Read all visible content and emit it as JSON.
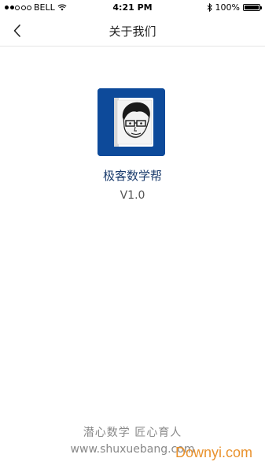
{
  "status_bar": {
    "carrier": "BELL",
    "time": "4:21 PM",
    "battery_percent": "100%"
  },
  "nav": {
    "title": "关于我们",
    "back_icon": "chevron-left-icon"
  },
  "app": {
    "name": "极客数学帮",
    "version": "V1.0",
    "brand_color": "#0d4a9a"
  },
  "footer": {
    "slogan": "潜心数学   匠心育人",
    "website": "www.shuxuebang.com"
  },
  "watermark": "Downyi.com"
}
